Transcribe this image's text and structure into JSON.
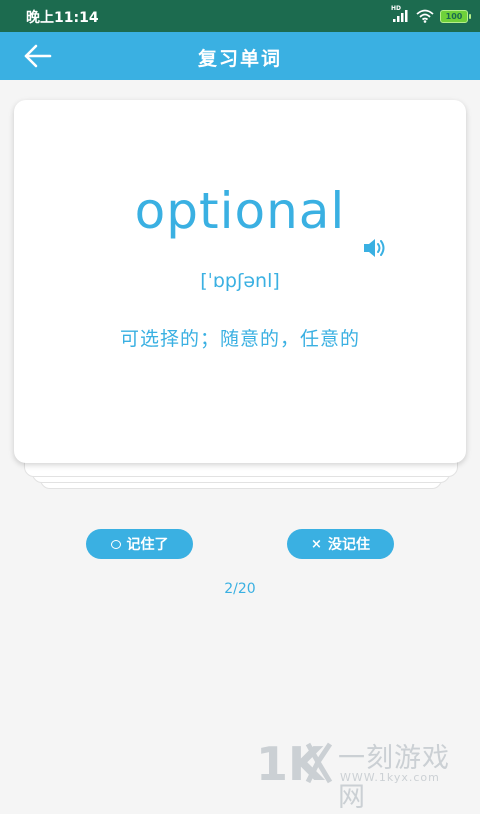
{
  "status_bar": {
    "time": "晚上11:14",
    "network": "HD",
    "battery": "100"
  },
  "app_bar": {
    "title": "复习单词",
    "back_icon": "arrow-left-icon"
  },
  "card": {
    "word": "optional",
    "phonetic": "[ˈɒpʃənl]",
    "meaning": "可选择的；随意的，任意的",
    "speaker_icon": "speaker-icon"
  },
  "actions": {
    "remember_label": "记住了",
    "forget_label": "没记住"
  },
  "progress": "2/20",
  "watermark": {
    "name": "一刻游戏网",
    "url": "WWW.1kyx.com"
  },
  "colors": {
    "accent": "#3ab0e2",
    "status_bar": "#1c6b4f",
    "background": "#f5f5f5"
  }
}
